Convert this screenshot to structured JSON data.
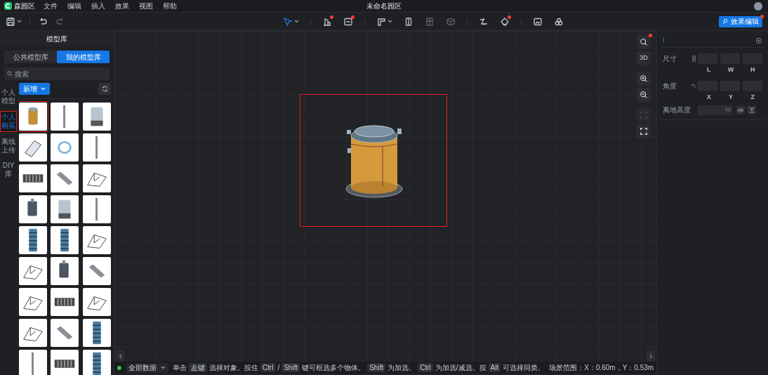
{
  "menu_bar": {
    "app_name": "森园区",
    "items": [
      "文件",
      "编辑",
      "插入",
      "效果",
      "视图",
      "帮助"
    ],
    "title": "未命名园区"
  },
  "toolbar": {
    "left": [
      {
        "kind": "save",
        "dropdown": true,
        "disabled": false
      },
      {
        "kind": "undo",
        "dropdown": false,
        "disabled": false
      },
      {
        "kind": "redo",
        "dropdown": false,
        "disabled": true
      }
    ],
    "center": [
      {
        "kind": "pointer",
        "dot": false,
        "dropdown": true,
        "disabled": false,
        "selected": true
      },
      {
        "kind": "building",
        "dot": true,
        "dropdown": false,
        "disabled": false,
        "selected": false
      },
      {
        "kind": "cad",
        "dot": true,
        "dropdown": false,
        "disabled": false,
        "selected": false
      },
      {
        "kind": "wall",
        "dot": false,
        "dropdown": true,
        "disabled": false,
        "selected": false
      },
      {
        "kind": "door",
        "dot": false,
        "dropdown": false,
        "disabled": false,
        "selected": false
      },
      {
        "kind": "window",
        "dot": false,
        "dropdown": false,
        "disabled": true,
        "selected": false
      },
      {
        "kind": "cube",
        "dot": false,
        "dropdown": false,
        "disabled": true,
        "selected": false
      },
      {
        "kind": "path",
        "dot": false,
        "dropdown": false,
        "disabled": false,
        "selected": false
      },
      {
        "kind": "plant",
        "dot": true,
        "dropdown": false,
        "disabled": false,
        "selected": false
      },
      {
        "kind": "image",
        "dot": false,
        "dropdown": false,
        "disabled": false,
        "selected": false
      },
      {
        "kind": "effect",
        "dot": false,
        "dropdown": false,
        "disabled": false,
        "selected": false
      }
    ],
    "effect_button": {
      "label": "效果编辑",
      "dot": true
    }
  },
  "left_panel": {
    "title": "模型库",
    "tabs": [
      {
        "label": "公共模型库",
        "selected": false
      },
      {
        "label": "我的模型库",
        "selected": true
      }
    ],
    "search": {
      "placeholder": "搜索"
    },
    "side_tabs": [
      {
        "label": "个人模型",
        "selected": false
      },
      {
        "label": "个人购买",
        "selected": true
      },
      {
        "label": "离线上传",
        "selected": false
      },
      {
        "label": "DIY库",
        "selected": false
      }
    ],
    "add_button": "新增",
    "models": [
      {
        "kind": "tank",
        "selected": true
      },
      {
        "kind": "pole",
        "selected": false
      },
      {
        "kind": "silo",
        "selected": false
      },
      {
        "kind": "box",
        "selected": false
      },
      {
        "kind": "ring",
        "selected": false
      },
      {
        "kind": "pole",
        "selected": false
      },
      {
        "kind": "grate",
        "selected": false
      },
      {
        "kind": "beam",
        "selected": false
      },
      {
        "kind": "frame",
        "selected": false
      },
      {
        "kind": "valve",
        "selected": false
      },
      {
        "kind": "silo",
        "selected": false
      },
      {
        "kind": "pole",
        "selected": false
      },
      {
        "kind": "tower",
        "selected": false
      },
      {
        "kind": "tower",
        "selected": false
      },
      {
        "kind": "frame",
        "selected": false
      },
      {
        "kind": "frame",
        "selected": false
      },
      {
        "kind": "valve",
        "selected": false
      },
      {
        "kind": "beam",
        "selected": false
      },
      {
        "kind": "frame",
        "selected": false
      },
      {
        "kind": "grate",
        "selected": false
      },
      {
        "kind": "frame",
        "selected": false
      },
      {
        "kind": "frame",
        "selected": false
      },
      {
        "kind": "beam",
        "selected": false
      },
      {
        "kind": "tower",
        "selected": false
      },
      {
        "kind": "pole",
        "selected": false
      },
      {
        "kind": "grate",
        "selected": false
      },
      {
        "kind": "tower",
        "selected": false
      }
    ]
  },
  "viewport": {
    "selection_box": true,
    "tools": [
      {
        "kind": "search",
        "dot": true,
        "disabled": false
      },
      {
        "kind": "mode",
        "label": "3D",
        "dot": false,
        "disabled": false
      },
      {
        "kind": "zoomin",
        "dot": false,
        "disabled": false
      },
      {
        "kind": "zoomout",
        "dot": false,
        "disabled": false
      },
      {
        "kind": "focus",
        "dot": false,
        "disabled": true
      },
      {
        "kind": "fullscreen",
        "dot": false,
        "disabled": false
      }
    ]
  },
  "status_bar": {
    "connected": true,
    "filter": "全部数据",
    "hint": [
      {
        "kind": "text",
        "text": "单击"
      },
      {
        "kind": "key",
        "text": "左键"
      },
      {
        "kind": "text",
        "text": "选择对象。按住"
      },
      {
        "kind": "key",
        "text": "Ctrl"
      },
      {
        "kind": "text",
        "text": "/"
      },
      {
        "kind": "key",
        "text": "Shift"
      },
      {
        "kind": "text",
        "text": "键可框选多个物体。"
      },
      {
        "kind": "key",
        "text": "Shift"
      },
      {
        "kind": "text",
        "text": "为加选。"
      },
      {
        "kind": "key",
        "text": "Ctrl"
      },
      {
        "kind": "text",
        "text": "为加选/减选。按"
      },
      {
        "kind": "key",
        "text": "Alt"
      },
      {
        "kind": "text",
        "text": "可选择同类。"
      }
    ],
    "scene_range": "场景范围：X：0.60m，Y：0.53m"
  },
  "properties": {
    "name": "I",
    "size": {
      "label": "尺寸",
      "axes": [
        "L",
        "W",
        "H"
      ]
    },
    "angle": {
      "label": "角度",
      "axes": [
        "X",
        "Y",
        "Z"
      ]
    },
    "height": {
      "label": "离地高度",
      "unit": "m"
    }
  }
}
